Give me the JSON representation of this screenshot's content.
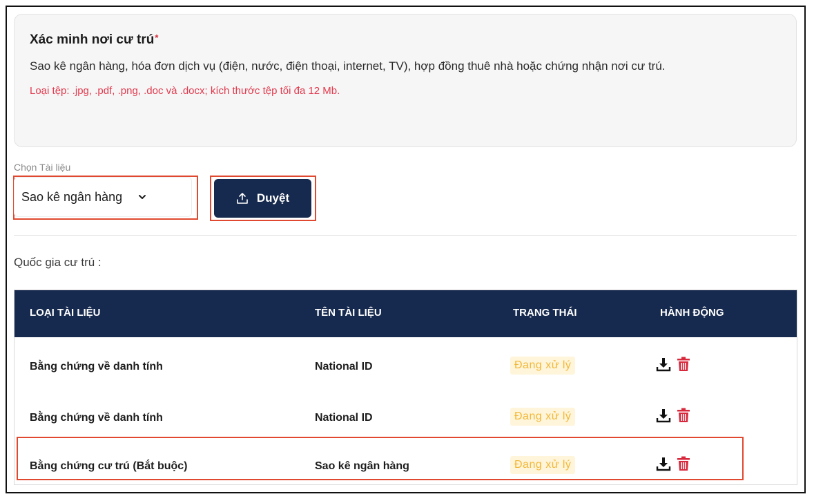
{
  "info": {
    "title": "Xác minh nơi cư trú",
    "required_mark": "*",
    "description": "Sao kê ngân hàng, hóa đơn dịch vụ (điện, nước, điện thoại, internet, TV), hợp đồng thuê nhà hoặc chứng nhận nơi cư trú.",
    "file_note": "Loại tệp: .jpg, .pdf, .png, .doc và .docx; kích thước tệp tối đa 12 Mb."
  },
  "select": {
    "label": "Chọn Tài liệu",
    "value": "Sao kê ngân hàng"
  },
  "browse_button": {
    "label": "Duyệt"
  },
  "country_label": "Quốc gia cư trú :",
  "table": {
    "headers": [
      "LOẠI TÀI LIỆU",
      "TÊN TÀI LIỆU",
      "TRẠNG THÁI",
      "HÀNH ĐỘNG"
    ],
    "rows": [
      {
        "type": "Bằng chứng về danh tính",
        "name": "National ID",
        "status": "Đang xử lý"
      },
      {
        "type": "Bằng chứng về danh tính",
        "name": "National ID",
        "status": "Đang xử lý"
      },
      {
        "type": "Bằng chứng cư trú (Bắt buộc)",
        "name": "Sao kê ngân hàng",
        "status": "Đang xử lý"
      }
    ]
  },
  "colors": {
    "header_bg": "#16294e",
    "highlight_border": "#e0492f",
    "required": "#d6293a",
    "note_text": "#e23a4e",
    "status_text": "#f2b736",
    "status_bg": "#fff5da",
    "delete_icon": "#d8283c"
  },
  "icons": {
    "select": "chevron-down-icon",
    "browse": "upload-icon",
    "download": "download-icon",
    "delete": "trash-icon"
  }
}
